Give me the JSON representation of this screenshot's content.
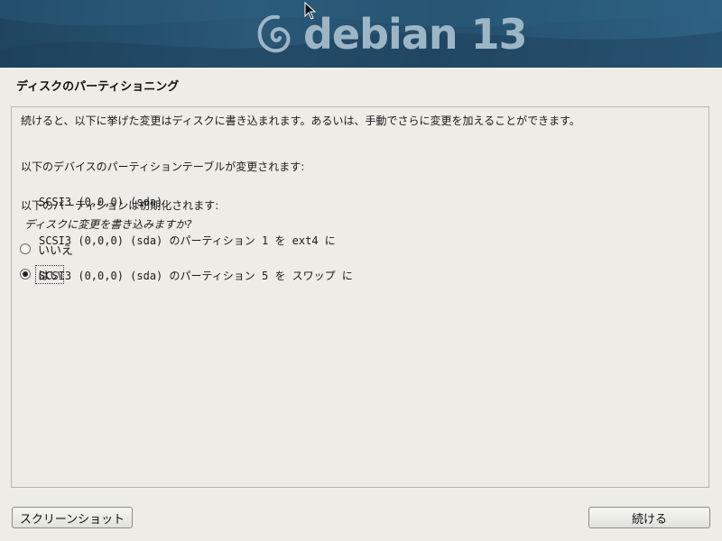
{
  "banner": {
    "logo_text": "debian 13"
  },
  "page": {
    "title": "ディスクのパーティショニング"
  },
  "content": {
    "intro": "続けると、以下に挙げた変更はディスクに書き込まれます。あるいは、手動でさらに変更を加えることができます。",
    "table_head": "以下のデバイスのパーティションテーブルが変更されます:",
    "table_devices": [
      "SCSI3 (0,0,0) (sda)"
    ],
    "format_head": "以下のパーティションは初期化されます:",
    "format_items": [
      "SCSI3 (0,0,0) (sda) のパーティション 1 を ext4 に",
      "SCSI3 (0,0,0) (sda) のパーティション 5 を スワップ に"
    ],
    "question": "ディスクに変更を書き込みますか?",
    "options": [
      {
        "label": "いいえ",
        "selected": false
      },
      {
        "label": "はい",
        "selected": true
      }
    ]
  },
  "buttons": {
    "screenshot": "スクリーンショット",
    "continue": "続ける"
  }
}
